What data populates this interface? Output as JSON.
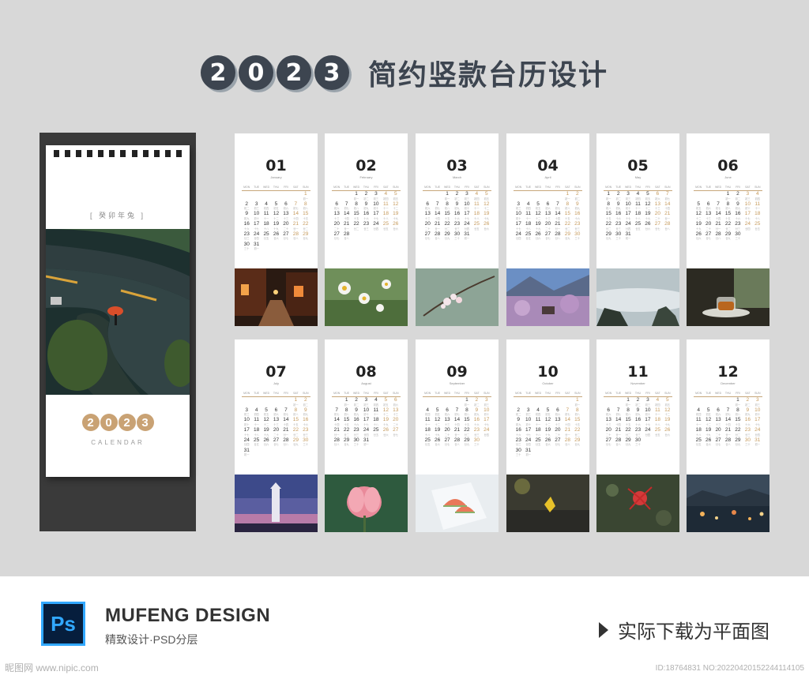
{
  "title": {
    "year_digits": [
      "2",
      "0",
      "2",
      "3"
    ],
    "text": "简约竖款台历设计"
  },
  "cover": {
    "subtitle": "[ 癸卯年兔 ]",
    "year_digits": [
      "2",
      "0",
      "2",
      "3"
    ],
    "calendar_label": "CALENDAR",
    "photo_icon": "umbrella-road-photo"
  },
  "weekdays": [
    "MON",
    "TUE",
    "WED",
    "THU",
    "FRI",
    "SAT",
    "SUN"
  ],
  "months": [
    {
      "num": "01",
      "en": "January",
      "start": 6,
      "days": 31,
      "photo": "night-street-photo"
    },
    {
      "num": "02",
      "en": "February",
      "start": 2,
      "days": 28,
      "photo": "daisy-photo"
    },
    {
      "num": "03",
      "en": "March",
      "start": 2,
      "days": 31,
      "photo": "blossom-photo"
    },
    {
      "num": "04",
      "en": "April",
      "start": 5,
      "days": 30,
      "photo": "mountain-village-photo"
    },
    {
      "num": "05",
      "en": "May",
      "start": 0,
      "days": 31,
      "photo": "sea-of-clouds-photo"
    },
    {
      "num": "06",
      "en": "June",
      "start": 3,
      "days": 30,
      "photo": "tea-cup-photo"
    },
    {
      "num": "07",
      "en": "July",
      "start": 5,
      "days": 31,
      "photo": "lighthouse-photo"
    },
    {
      "num": "08",
      "en": "August",
      "start": 1,
      "days": 31,
      "photo": "lotus-photo"
    },
    {
      "num": "09",
      "en": "September",
      "start": 4,
      "days": 30,
      "photo": "watermelon-photo"
    },
    {
      "num": "10",
      "en": "October",
      "start": 6,
      "days": 31,
      "photo": "leaf-photo"
    },
    {
      "num": "11",
      "en": "November",
      "start": 2,
      "days": 30,
      "photo": "red-flower-photo"
    },
    {
      "num": "12",
      "en": "December",
      "start": 4,
      "days": 31,
      "photo": "city-lights-photo"
    }
  ],
  "footer": {
    "ps_label": "Ps",
    "brand": "MUFENG DESIGN",
    "brand_sub": "精致设计·PSD分层",
    "download_text": "实际下载为平面图",
    "watermark_left": "昵图网 www.nipic.com",
    "watermark_right": "ID:18764831 NO:20220420152244114105"
  },
  "colors": {
    "title": "#3d4550",
    "accent": "#c9a274",
    "background": "#d8d8d8",
    "ps_blue": "#31a8ff"
  }
}
